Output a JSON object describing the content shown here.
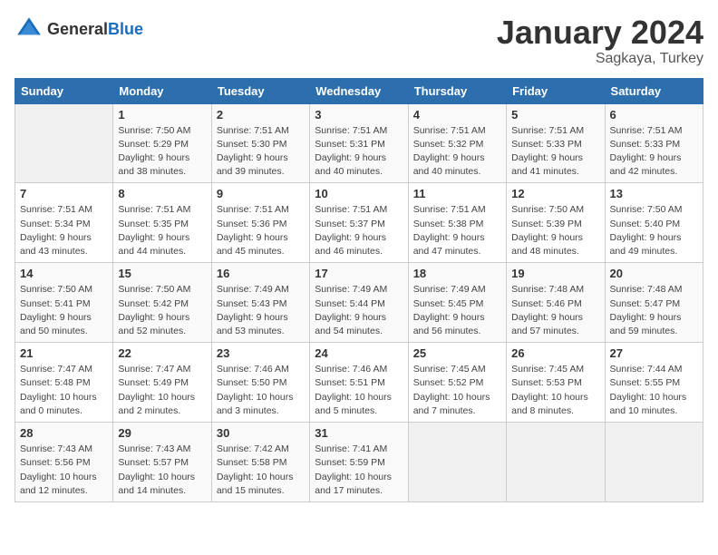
{
  "logo": {
    "general": "General",
    "blue": "Blue"
  },
  "header": {
    "title": "January 2024",
    "subtitle": "Sagkaya, Turkey"
  },
  "weekdays": [
    "Sunday",
    "Monday",
    "Tuesday",
    "Wednesday",
    "Thursday",
    "Friday",
    "Saturday"
  ],
  "weeks": [
    [
      {
        "day": "",
        "empty": true
      },
      {
        "day": "1",
        "sunrise": "7:50 AM",
        "sunset": "5:29 PM",
        "daylight": "9 hours and 38 minutes."
      },
      {
        "day": "2",
        "sunrise": "7:51 AM",
        "sunset": "5:30 PM",
        "daylight": "9 hours and 39 minutes."
      },
      {
        "day": "3",
        "sunrise": "7:51 AM",
        "sunset": "5:31 PM",
        "daylight": "9 hours and 40 minutes."
      },
      {
        "day": "4",
        "sunrise": "7:51 AM",
        "sunset": "5:32 PM",
        "daylight": "9 hours and 40 minutes."
      },
      {
        "day": "5",
        "sunrise": "7:51 AM",
        "sunset": "5:33 PM",
        "daylight": "9 hours and 41 minutes."
      },
      {
        "day": "6",
        "sunrise": "7:51 AM",
        "sunset": "5:33 PM",
        "daylight": "9 hours and 42 minutes."
      }
    ],
    [
      {
        "day": "7",
        "sunrise": "7:51 AM",
        "sunset": "5:34 PM",
        "daylight": "9 hours and 43 minutes."
      },
      {
        "day": "8",
        "sunrise": "7:51 AM",
        "sunset": "5:35 PM",
        "daylight": "9 hours and 44 minutes."
      },
      {
        "day": "9",
        "sunrise": "7:51 AM",
        "sunset": "5:36 PM",
        "daylight": "9 hours and 45 minutes."
      },
      {
        "day": "10",
        "sunrise": "7:51 AM",
        "sunset": "5:37 PM",
        "daylight": "9 hours and 46 minutes."
      },
      {
        "day": "11",
        "sunrise": "7:51 AM",
        "sunset": "5:38 PM",
        "daylight": "9 hours and 47 minutes."
      },
      {
        "day": "12",
        "sunrise": "7:50 AM",
        "sunset": "5:39 PM",
        "daylight": "9 hours and 48 minutes."
      },
      {
        "day": "13",
        "sunrise": "7:50 AM",
        "sunset": "5:40 PM",
        "daylight": "9 hours and 49 minutes."
      }
    ],
    [
      {
        "day": "14",
        "sunrise": "7:50 AM",
        "sunset": "5:41 PM",
        "daylight": "9 hours and 50 minutes."
      },
      {
        "day": "15",
        "sunrise": "7:50 AM",
        "sunset": "5:42 PM",
        "daylight": "9 hours and 52 minutes."
      },
      {
        "day": "16",
        "sunrise": "7:49 AM",
        "sunset": "5:43 PM",
        "daylight": "9 hours and 53 minutes."
      },
      {
        "day": "17",
        "sunrise": "7:49 AM",
        "sunset": "5:44 PM",
        "daylight": "9 hours and 54 minutes."
      },
      {
        "day": "18",
        "sunrise": "7:49 AM",
        "sunset": "5:45 PM",
        "daylight": "9 hours and 56 minutes."
      },
      {
        "day": "19",
        "sunrise": "7:48 AM",
        "sunset": "5:46 PM",
        "daylight": "9 hours and 57 minutes."
      },
      {
        "day": "20",
        "sunrise": "7:48 AM",
        "sunset": "5:47 PM",
        "daylight": "9 hours and 59 minutes."
      }
    ],
    [
      {
        "day": "21",
        "sunrise": "7:47 AM",
        "sunset": "5:48 PM",
        "daylight": "10 hours and 0 minutes."
      },
      {
        "day": "22",
        "sunrise": "7:47 AM",
        "sunset": "5:49 PM",
        "daylight": "10 hours and 2 minutes."
      },
      {
        "day": "23",
        "sunrise": "7:46 AM",
        "sunset": "5:50 PM",
        "daylight": "10 hours and 3 minutes."
      },
      {
        "day": "24",
        "sunrise": "7:46 AM",
        "sunset": "5:51 PM",
        "daylight": "10 hours and 5 minutes."
      },
      {
        "day": "25",
        "sunrise": "7:45 AM",
        "sunset": "5:52 PM",
        "daylight": "10 hours and 7 minutes."
      },
      {
        "day": "26",
        "sunrise": "7:45 AM",
        "sunset": "5:53 PM",
        "daylight": "10 hours and 8 minutes."
      },
      {
        "day": "27",
        "sunrise": "7:44 AM",
        "sunset": "5:55 PM",
        "daylight": "10 hours and 10 minutes."
      }
    ],
    [
      {
        "day": "28",
        "sunrise": "7:43 AM",
        "sunset": "5:56 PM",
        "daylight": "10 hours and 12 minutes."
      },
      {
        "day": "29",
        "sunrise": "7:43 AM",
        "sunset": "5:57 PM",
        "daylight": "10 hours and 14 minutes."
      },
      {
        "day": "30",
        "sunrise": "7:42 AM",
        "sunset": "5:58 PM",
        "daylight": "10 hours and 15 minutes."
      },
      {
        "day": "31",
        "sunrise": "7:41 AM",
        "sunset": "5:59 PM",
        "daylight": "10 hours and 17 minutes."
      },
      {
        "day": "",
        "empty": true
      },
      {
        "day": "",
        "empty": true
      },
      {
        "day": "",
        "empty": true
      }
    ]
  ]
}
